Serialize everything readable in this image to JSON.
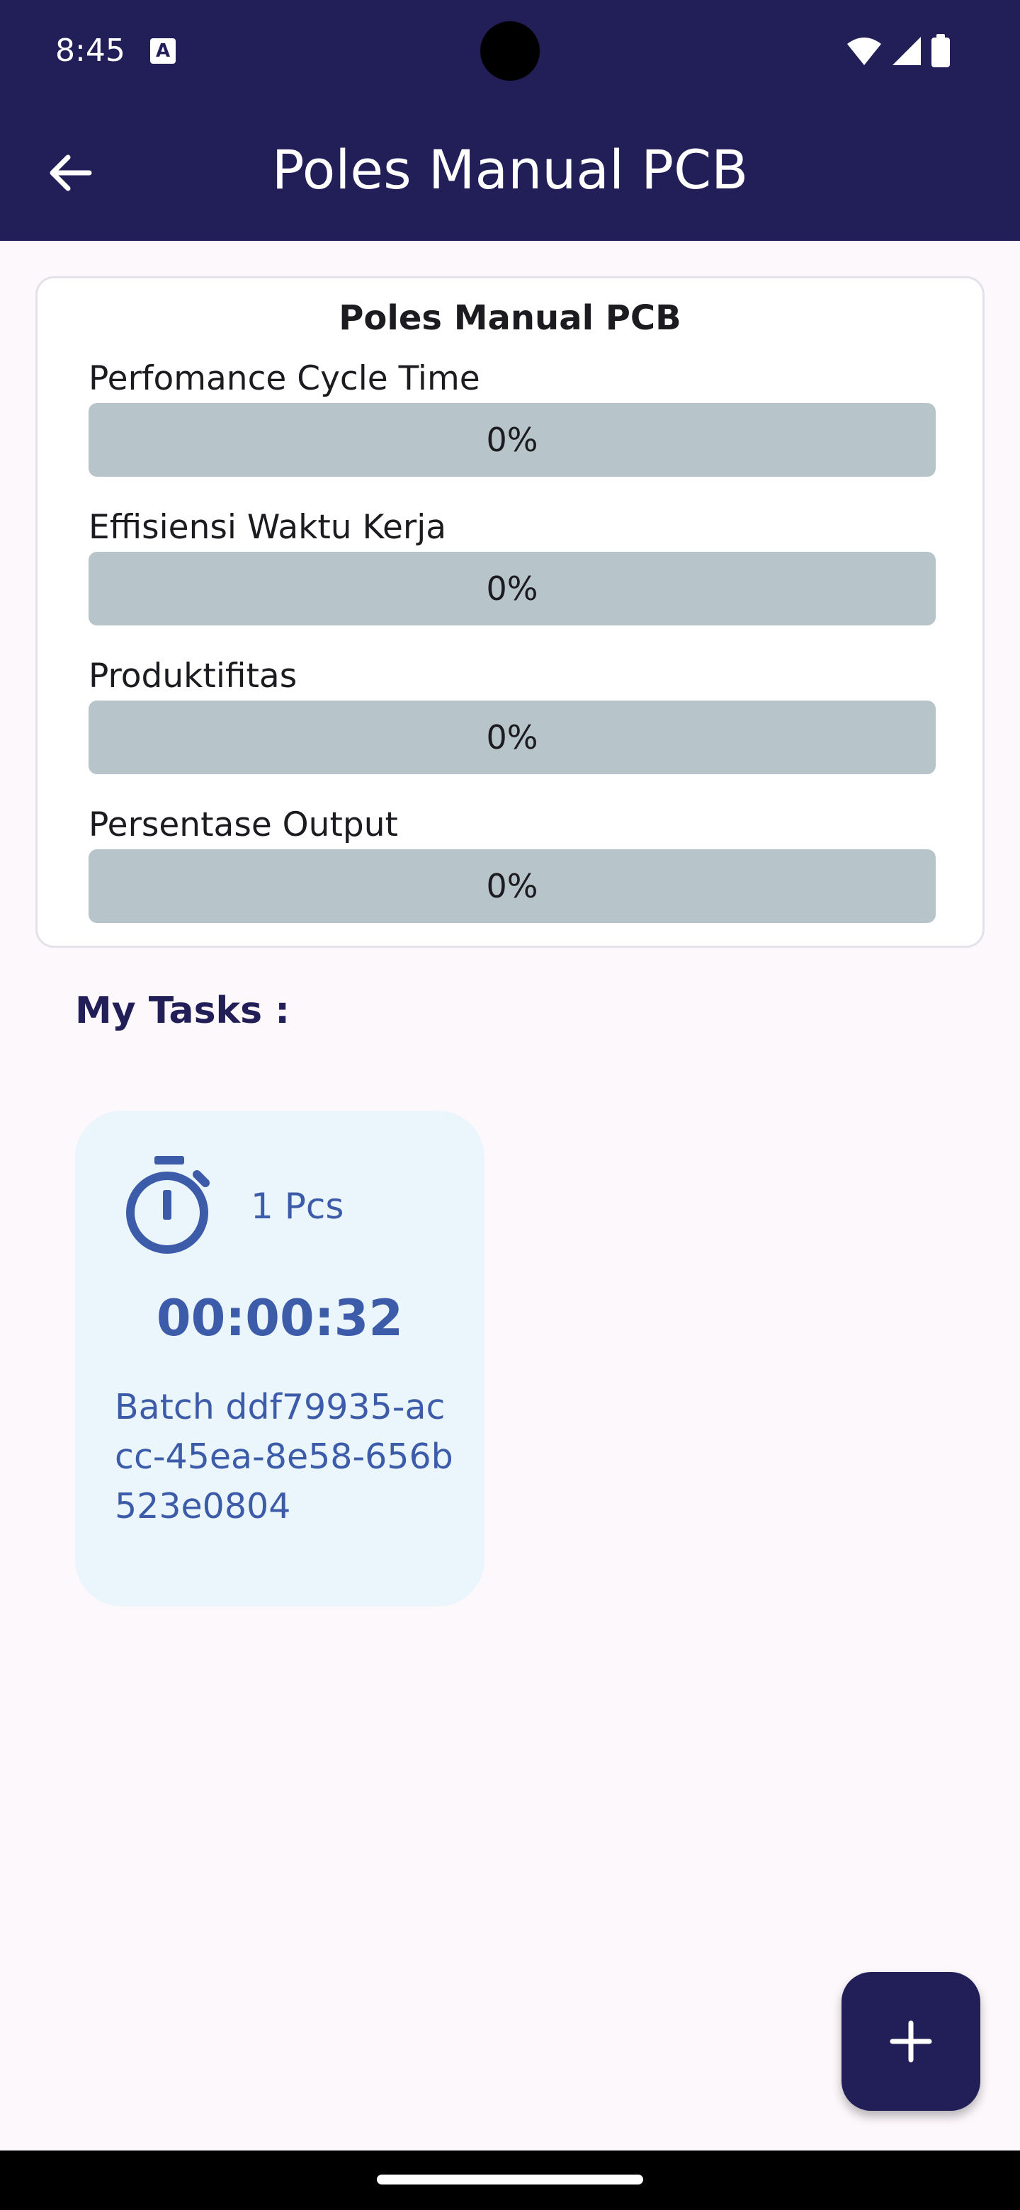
{
  "status_bar": {
    "time": "8:45",
    "notification_icon": "a-letter-icon",
    "icons": [
      "wifi-icon",
      "signal-icon",
      "battery-icon"
    ]
  },
  "app_bar": {
    "back_icon": "arrow-left-icon",
    "title": "Poles Manual PCB"
  },
  "performance": {
    "title": "Poles Manual PCB",
    "metrics": [
      {
        "label": "Perfomance Cycle Time",
        "value": "0%",
        "fraction": 0
      },
      {
        "label": "Effisiensi Waktu Kerja",
        "value": "0%",
        "fraction": 0
      },
      {
        "label": "Produktifitas",
        "value": "0%",
        "fraction": 0
      },
      {
        "label": "Persentase Output",
        "value": "0%",
        "fraction": 0
      }
    ]
  },
  "tasks": {
    "heading": "My Tasks :",
    "items": [
      {
        "icon": "stopwatch-icon",
        "quantity": "1 Pcs",
        "elapsed": "00:00:32",
        "batch": "Batch ddf79935-accc-45ea-8e58-656b523e0804"
      }
    ]
  },
  "fab": {
    "icon": "plus-icon"
  },
  "colors": {
    "primary": "#221f58",
    "accent": "#3c5ba9",
    "bar_track": "#b7c5ca",
    "task_card_bg": "#ebf5fc",
    "background": "#fdf8fc"
  }
}
